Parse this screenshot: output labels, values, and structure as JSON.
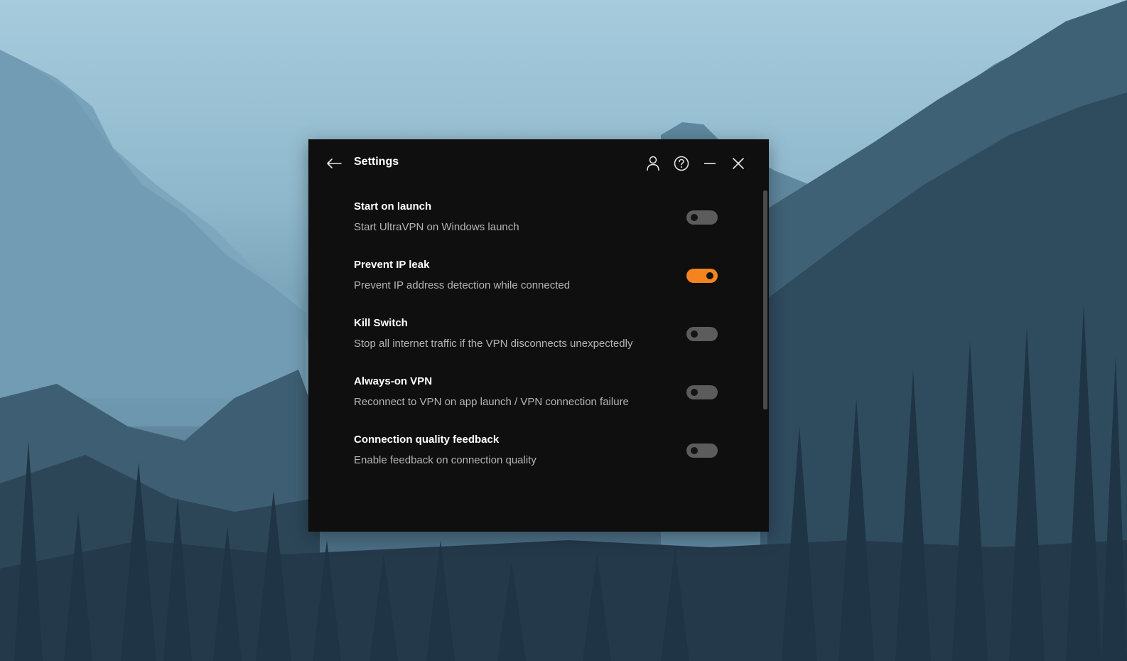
{
  "window": {
    "title": "Settings"
  },
  "settings": [
    {
      "title": "Start on launch",
      "description": "Start UltraVPN on Windows launch",
      "enabled": false
    },
    {
      "title": "Prevent IP leak",
      "description": "Prevent IP address detection while connected",
      "enabled": true
    },
    {
      "title": "Kill Switch",
      "description": "Stop all internet traffic if the VPN disconnects unexpectedly",
      "enabled": false
    },
    {
      "title": "Always-on VPN",
      "description": "Reconnect to VPN on app launch / VPN connection failure",
      "enabled": false
    },
    {
      "title": "Connection quality feedback",
      "description": "Enable feedback on connection quality",
      "enabled": false
    }
  ],
  "icons": {
    "back": "arrow-left-icon",
    "account": "user-icon",
    "help": "help-circle-icon",
    "minimize": "minimize-icon",
    "close": "close-icon"
  },
  "colors": {
    "window_bg": "#0f0f0f",
    "accent": "#f5841f",
    "toggle_off": "#5c5c5c",
    "description_text": "#b5b5b5"
  }
}
